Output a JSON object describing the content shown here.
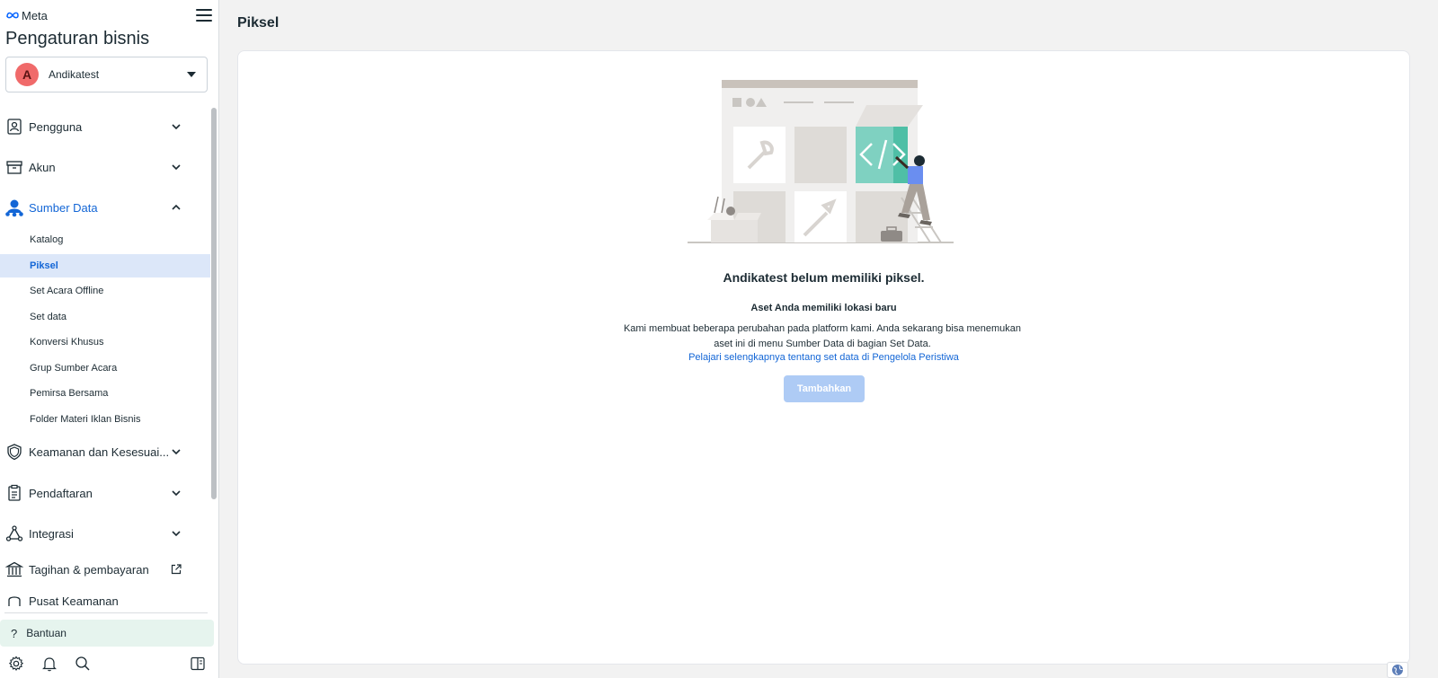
{
  "brand": {
    "logo_text": "Meta"
  },
  "sidebar": {
    "title": "Pengaturan bisnis",
    "business": {
      "avatar_letter": "A",
      "name": "Andikatest"
    },
    "items": [
      {
        "label": "Pengguna",
        "icon": "users-icon"
      },
      {
        "label": "Akun",
        "icon": "box-icon"
      },
      {
        "label": "Sumber Data",
        "icon": "data-sources-icon",
        "expanded": true
      },
      {
        "label": "Keamanan dan Kesesuai...",
        "icon": "shield-icon"
      },
      {
        "label": "Pendaftaran",
        "icon": "clipboard-icon"
      },
      {
        "label": "Integrasi",
        "icon": "integrations-icon"
      },
      {
        "label": "Tagihan & pembayaran",
        "icon": "bank-icon"
      },
      {
        "label": "Pusat Keamanan",
        "icon": "person-icon"
      }
    ],
    "sub_items": [
      "Katalog",
      "Piksel",
      "Set Acara Offline",
      "Set data",
      "Konversi Khusus",
      "Grup Sumber Acara",
      "Pemirsa Bersama",
      "Folder Materi Iklan Bisnis"
    ],
    "selected_sub_item": "Piksel",
    "help_label": "Bantuan",
    "accent_color": "#1366d6"
  },
  "main": {
    "page_title": "Piksel",
    "empty_state": {
      "heading": "Andikatest belum memiliki piksel.",
      "subheading": "Aset Anda memiliki lokasi baru",
      "description": "Kami membuat beberapa perubahan pada platform kami. Anda sekarang bisa menemukan aset ini di menu Sumber Data di bagian Set Data.",
      "link": "Pelajari selengkapnya tentang set data di Pengelola Peristiwa",
      "button": "Tambahkan"
    }
  }
}
